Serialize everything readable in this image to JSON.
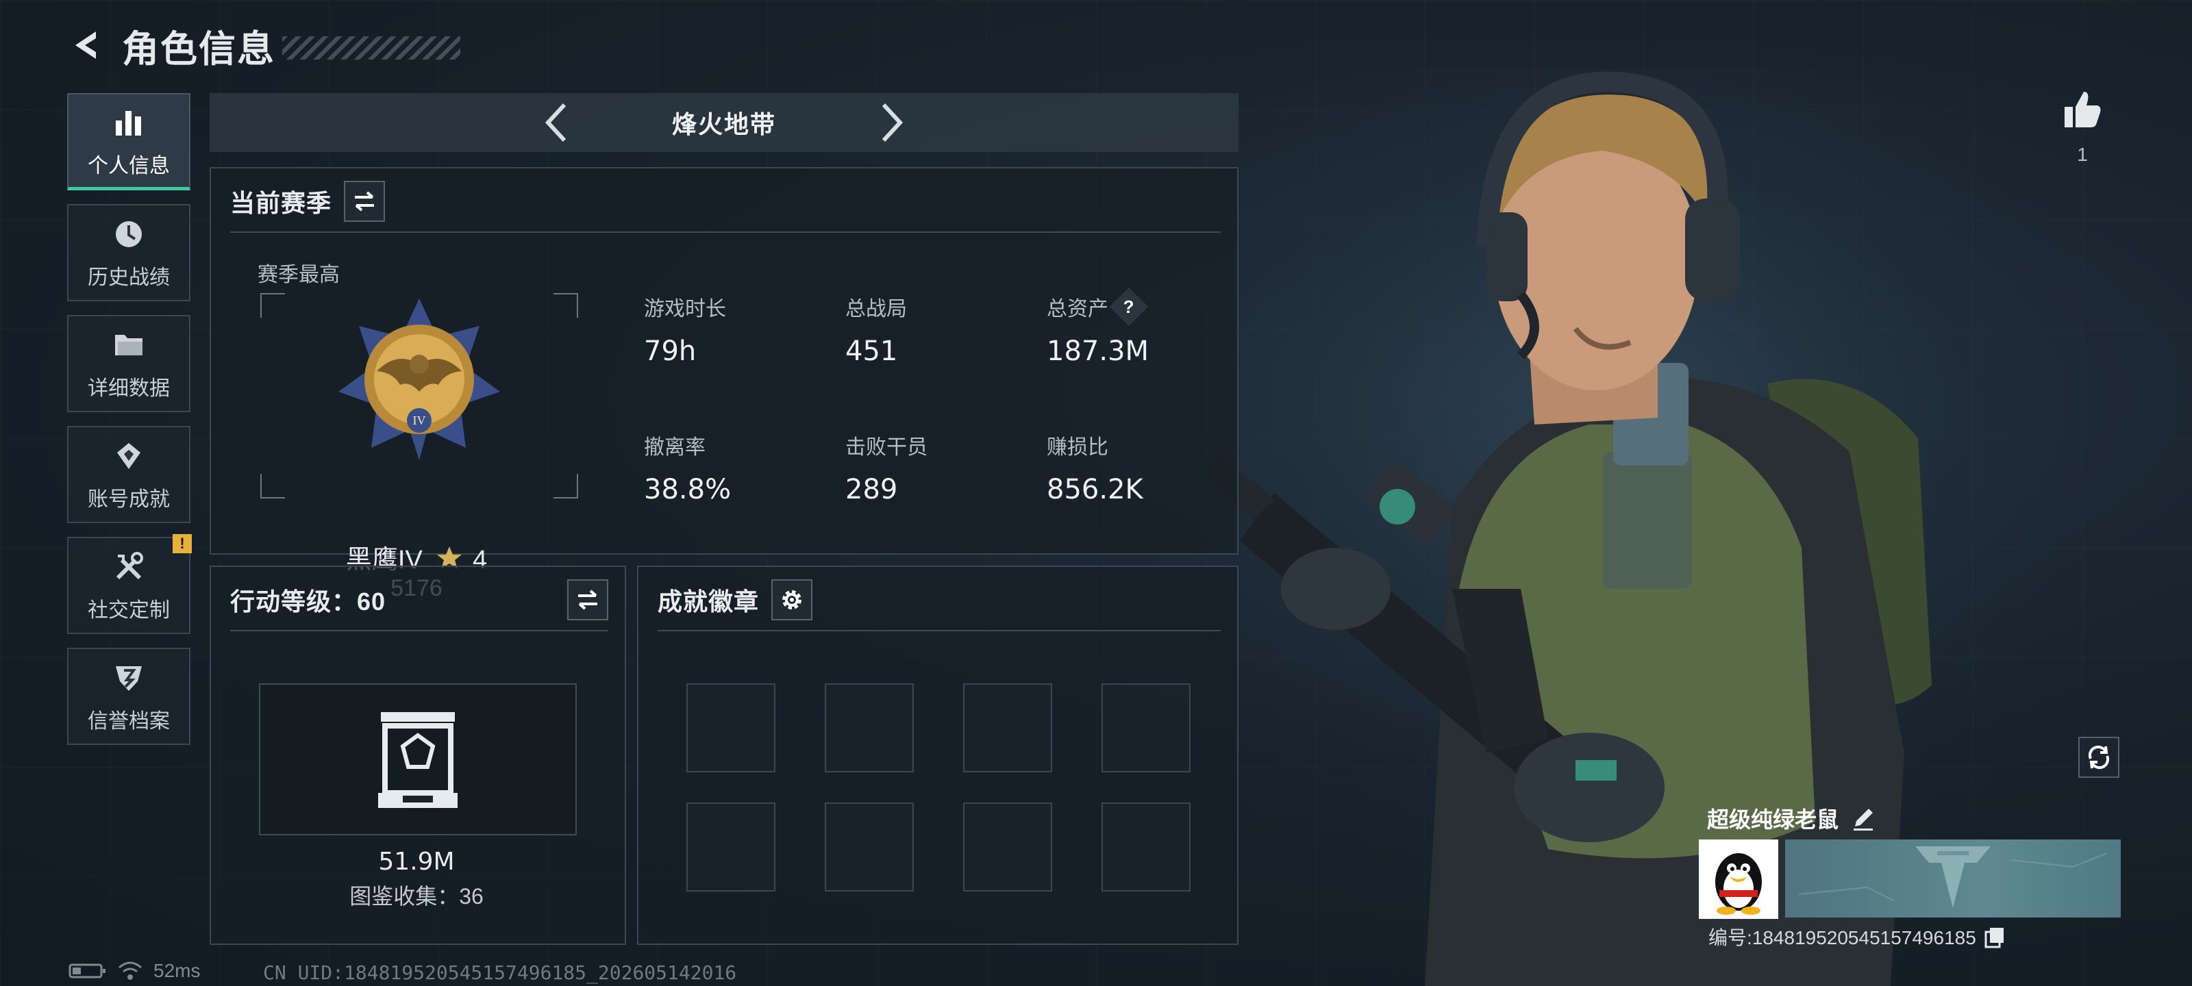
{
  "header": {
    "title": "角色信息"
  },
  "sidebar": {
    "items": [
      {
        "label": "个人信息",
        "icon": "bar-chart-icon",
        "active": true
      },
      {
        "label": "历史战绩",
        "icon": "clock-icon",
        "active": false
      },
      {
        "label": "详细数据",
        "icon": "folder-icon",
        "active": false
      },
      {
        "label": "账号成就",
        "icon": "achievement-icon",
        "active": false
      },
      {
        "label": "社交定制",
        "icon": "tools-icon",
        "active": false,
        "alert": "!"
      },
      {
        "label": "信誉档案",
        "icon": "shield-icon",
        "active": false
      }
    ]
  },
  "mode": {
    "name": "烽火地带"
  },
  "season": {
    "title": "当前赛季",
    "best_label": "赛季最高",
    "rank_name": "黑鹰IV",
    "rank_stars": "4",
    "rank_score": "5176",
    "stats": [
      {
        "label": "游戏时长",
        "value": "79h"
      },
      {
        "label": "总战局",
        "value": "451"
      },
      {
        "label": "总资产",
        "value": "187.3M",
        "help": "?"
      },
      {
        "label": "撤离率",
        "value": "38.8%"
      },
      {
        "label": "击败干员",
        "value": "289"
      },
      {
        "label": "赚损比",
        "value": "856.2K"
      }
    ]
  },
  "action_level": {
    "title": "行动等级：60",
    "codex_value": "51.9M",
    "codex_count": "图鉴收集：36"
  },
  "achievements": {
    "title": "成就徽章",
    "slots": 8
  },
  "likes": {
    "count": "1"
  },
  "player": {
    "name": "超级纯绿老鼠",
    "id_text": "编号:18481952054515749618​5"
  },
  "status": {
    "ping": "52ms",
    "uid": "CN UID:18481952054515749618​5_202605142016"
  },
  "colors": {
    "accent": "#3ec9a0",
    "alert": "#e8b23a",
    "bg": "#18222c"
  }
}
